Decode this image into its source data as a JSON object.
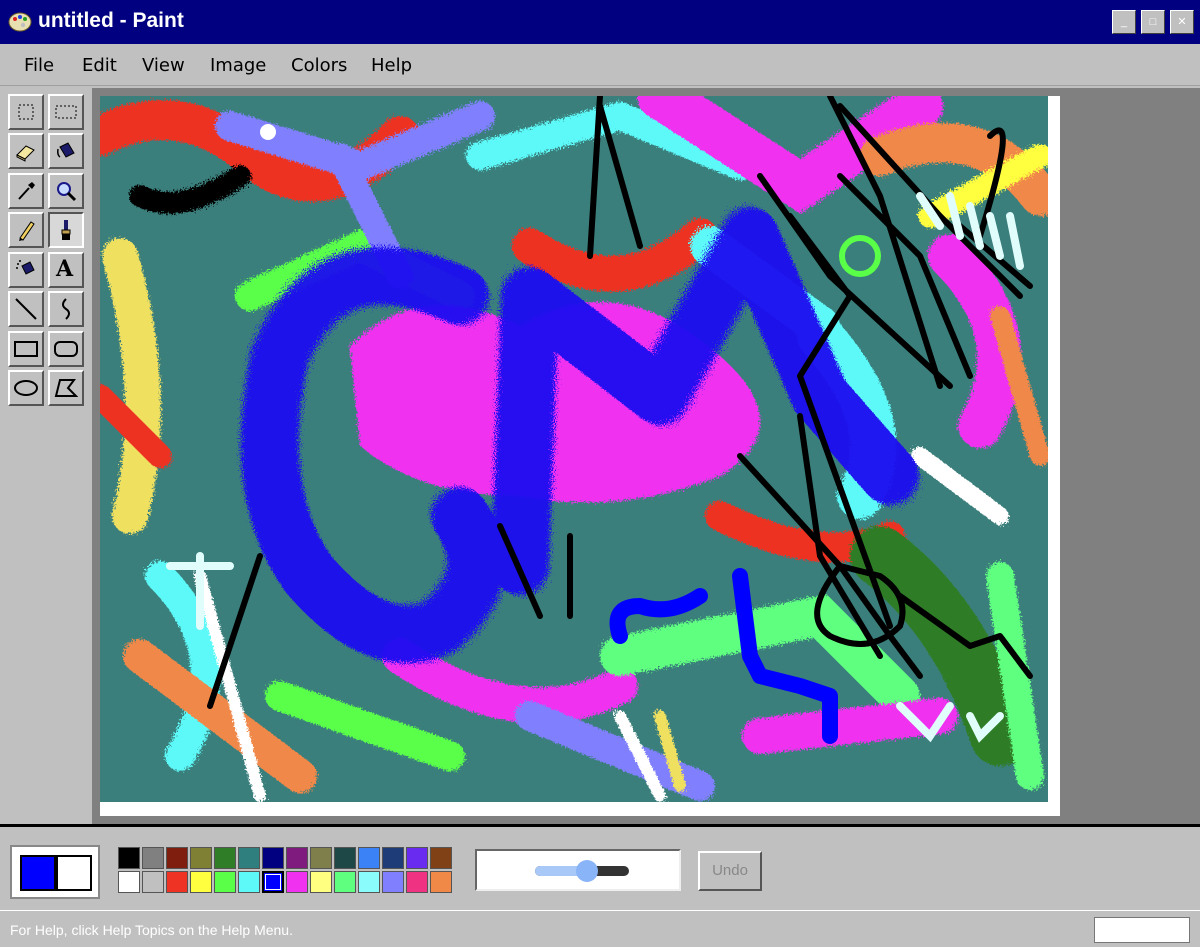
{
  "window": {
    "title": "untitled - Paint",
    "min_glyph": "_",
    "max_glyph": "□",
    "close_glyph": "✕"
  },
  "menu": {
    "items": [
      "File",
      "Edit",
      "View",
      "Image",
      "Colors",
      "Help"
    ]
  },
  "toolbox": {
    "tools": [
      {
        "name": "free-form-select-icon",
        "active": false
      },
      {
        "name": "rectangle-select-icon",
        "active": false
      },
      {
        "name": "eraser-icon",
        "active": false
      },
      {
        "name": "fill-bucket-icon",
        "active": false
      },
      {
        "name": "eyedropper-icon",
        "active": false
      },
      {
        "name": "magnifier-icon",
        "active": false
      },
      {
        "name": "pencil-icon",
        "active": false
      },
      {
        "name": "brush-icon",
        "active": true
      },
      {
        "name": "airbrush-icon",
        "active": false
      },
      {
        "name": "text-icon",
        "active": false
      },
      {
        "name": "line-icon",
        "active": false
      },
      {
        "name": "curve-icon",
        "active": false
      },
      {
        "name": "rectangle-icon",
        "active": false
      },
      {
        "name": "rounded-rectangle-icon",
        "active": false
      },
      {
        "name": "ellipse-icon",
        "active": false
      },
      {
        "name": "polygon-icon",
        "active": false
      }
    ],
    "text_tool_glyph": "A"
  },
  "colors": {
    "foreground": "#0000ff",
    "background": "#ffffff",
    "palette_top": [
      "#000000",
      "#808080",
      "#7f1d0f",
      "#808034",
      "#2f7d27",
      "#2f7f7e",
      "#000080",
      "#7f1a7e",
      "#7f7f4c",
      "#1e4848",
      "#3b82f6",
      "#1e3c78",
      "#6a2bf0",
      "#7f4115"
    ],
    "palette_bottom": [
      "#ffffff",
      "#c0c0c0",
      "#ee3224",
      "#ffff40",
      "#5aff48",
      "#5cf9f8",
      "#0000ff",
      "#f032f0",
      "#ffff80",
      "#5fff80",
      "#8afcfc",
      "#8080ff",
      "#ef3382",
      "#f08848"
    ],
    "selected_swatch": "#0000ff"
  },
  "brush": {
    "size_fraction": 0.55
  },
  "undo": {
    "label": "Undo"
  },
  "status": {
    "text": "For Help, click Help Topics on the Help Menu."
  }
}
